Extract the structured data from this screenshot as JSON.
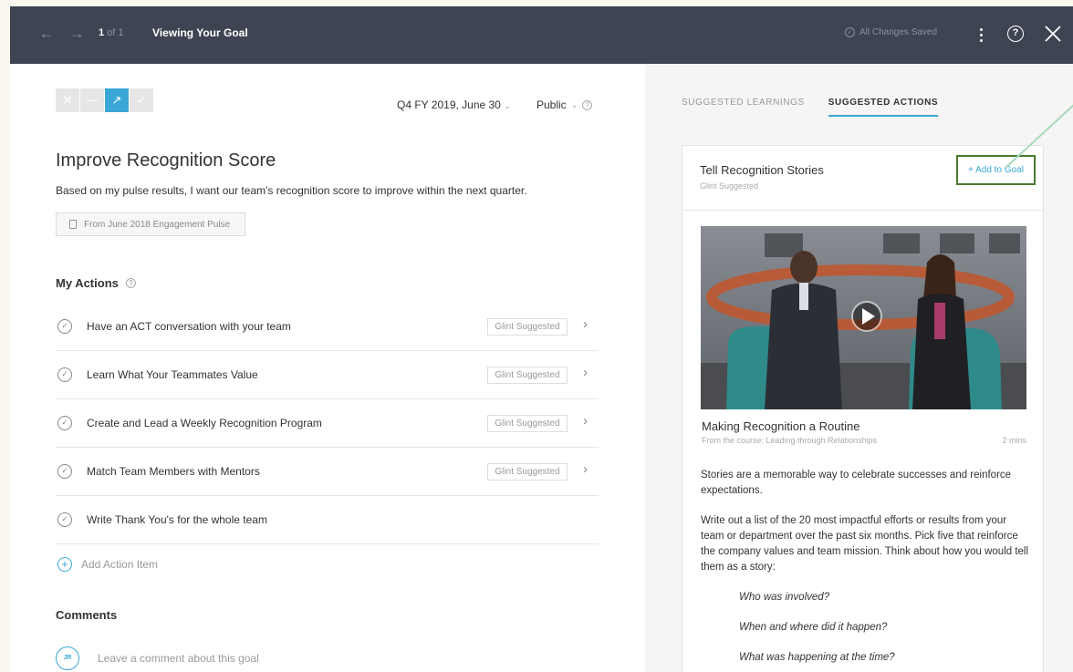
{
  "header": {
    "page_current": "1",
    "page_total": "of 1",
    "title": "Viewing Your Goal",
    "save_status": "All Changes Saved"
  },
  "goal": {
    "period": "Q4 FY 2019, June 30",
    "visibility": "Public",
    "title": "Improve Recognition Score",
    "description": "Based on my pulse results, I want our team's recognition score to improve within the next quarter.",
    "source": "From June 2018 Engagement Pulse"
  },
  "actions": {
    "heading": "My Actions",
    "items": [
      {
        "label": "Have an ACT conversation with your team",
        "badge": "Glint Suggested"
      },
      {
        "label": "Learn What Your Teammates Value",
        "badge": "Glint Suggested"
      },
      {
        "label": "Create and Lead a Weekly Recognition Program",
        "badge": "Glint Suggested"
      },
      {
        "label": "Match Team Members with Mentors",
        "badge": "Glint Suggested"
      },
      {
        "label": "Write Thank You's for the whole team"
      }
    ],
    "add_label": "Add Action Item"
  },
  "comments": {
    "heading": "Comments",
    "avatar_initials": "JR",
    "placeholder": "Leave a comment about this goal"
  },
  "right_panel": {
    "tabs": [
      {
        "label": "SUGGESTED LEARNINGS",
        "active": false
      },
      {
        "label": "SUGGESTED ACTIONS",
        "active": true
      }
    ],
    "card": {
      "title": "Tell Recognition Stories",
      "subtitle": "Glint Suggested",
      "add_label": "+ Add to Goal",
      "video_title": "Making Recognition a Routine",
      "video_course": "From the course: Leading through Relationships",
      "video_duration": "2 mins",
      "para1": "Stories are a memorable way to celebrate successes and reinforce expectations.",
      "para2": "Write out a list of the 20 most impactful efforts or results from your team or department over the past six months. Pick five that reinforce the company values and team mission. Think about how you would tell them as a story:",
      "questions": [
        "Who was involved?",
        "When and where did it happen?",
        "What was happening at the time?"
      ]
    }
  },
  "colors": {
    "header_bg": "#3e4452",
    "accent": "#3aa7d6",
    "highlight_box": "#4a7a2e",
    "pointer_line": "#a9d8b8"
  }
}
